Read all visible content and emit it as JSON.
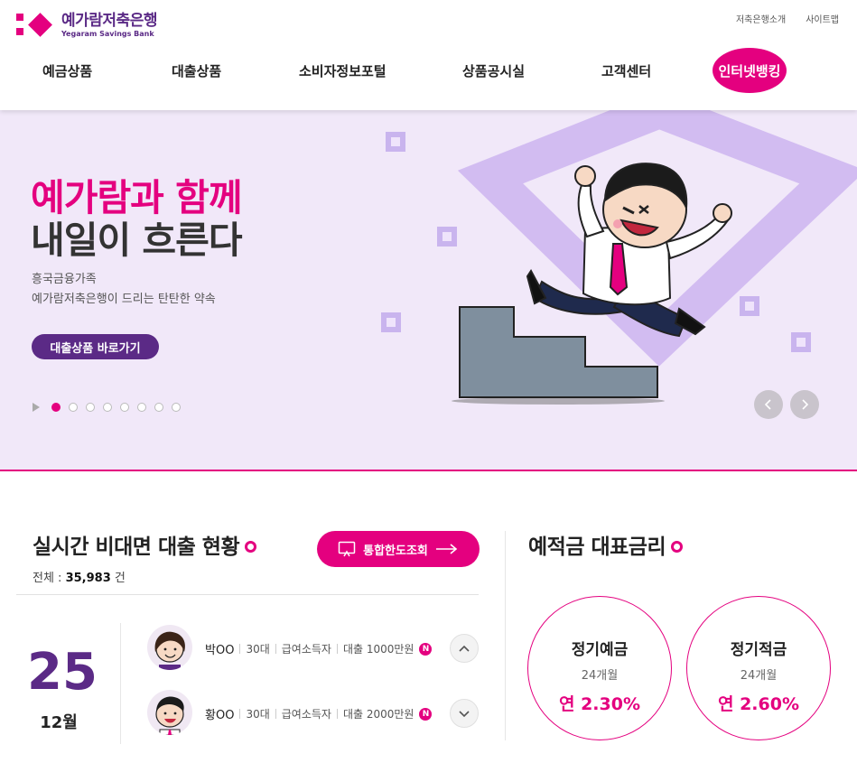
{
  "brand": {
    "name_kr": "예가람저축은행",
    "name_en": "Yegaram Savings Bank",
    "accent_color": "#e4007f",
    "purple_color": "#5b2a86"
  },
  "util_links": [
    "저축은행소개",
    "사이트맵"
  ],
  "gnb": [
    "예금상품",
    "대출상품",
    "소비자정보포털",
    "상품공시실",
    "고객센터",
    "인터넷뱅킹"
  ],
  "hero": {
    "title_line1": "예가람과 함께",
    "title_line2": "내일이 흐른다",
    "sub_line1": "흥국금융가족",
    "sub_line2": "예가람저축은행이 드리는 탄탄한 약속",
    "button_label": "대출상품 바로가기",
    "slide_count": 8,
    "active_slide": 1
  },
  "loan_status": {
    "title": "실시간 비대면 대출 현황",
    "total_label": "전체 : ",
    "total_count": "35,983",
    "total_unit": " 건",
    "limit_button": "통합한도조회",
    "day": "25",
    "month": "12월",
    "rows": [
      {
        "name": "박OO",
        "age": "30대",
        "job": "급여소득자",
        "amount": "대출 1000만원",
        "badge": "N",
        "avatar": "female-avatar"
      },
      {
        "name": "황OO",
        "age": "30대",
        "job": "급여소득자",
        "amount": "대출 2000만원",
        "badge": "N",
        "avatar": "male-avatar"
      }
    ]
  },
  "rates": {
    "title": "예적금 대표금리",
    "items": [
      {
        "name": "정기예금",
        "term": "24개월",
        "rate": "연 2.30%"
      },
      {
        "name": "정기적금",
        "term": "24개월",
        "rate": "연 2.60%"
      }
    ]
  },
  "icons": [
    "play-icon",
    "chevron-left-icon",
    "chevron-right-icon",
    "monitor-icon",
    "arrow-right-icon",
    "chevron-up-icon",
    "chevron-down-icon"
  ]
}
